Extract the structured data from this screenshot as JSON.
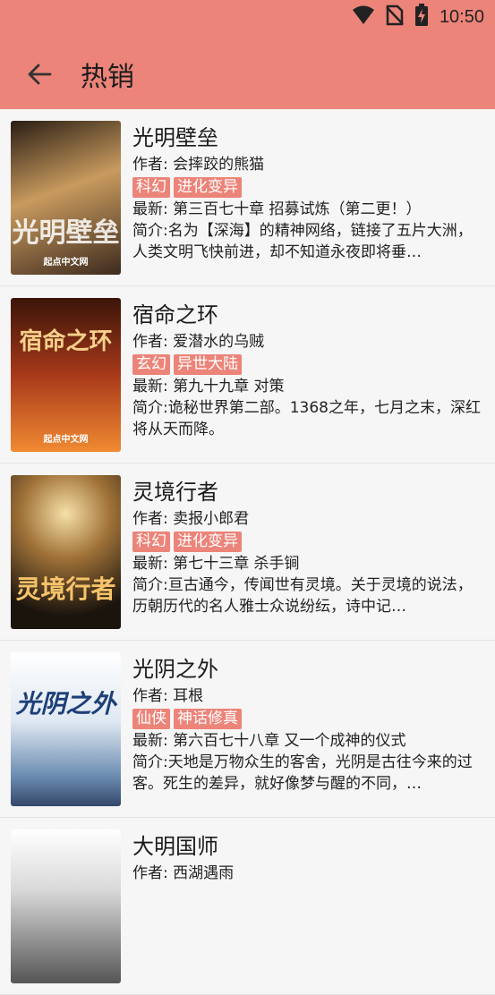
{
  "status": {
    "time": "10:50"
  },
  "toolbar": {
    "title": "热销"
  },
  "books": [
    {
      "title": "光明壁垒",
      "author": "作者: 会摔跤的熊猫",
      "tags": [
        "科幻",
        "进化变异"
      ],
      "latest": "最新: 第三百七十章 招募试炼（第二更！）",
      "intro": "简介:名为【深海】的精神网络，链接了五片大洲，人类文明飞快前进，却不知道永夜即将垂…",
      "cover_colors": [
        "#3a2a1e",
        "#d8b278",
        "#6b4f3a"
      ]
    },
    {
      "title": "宿命之环",
      "author": "作者: 爱潜水的乌贼",
      "tags": [
        "玄幻",
        "异世大陆"
      ],
      "latest": "最新: 第九十九章 对策",
      "intro": "简介:诡秘世界第二部。1368之年，七月之末，深红将从天而降。",
      "cover_colors": [
        "#2a0f08",
        "#c4481c",
        "#f39a3a"
      ]
    },
    {
      "title": "灵境行者",
      "author": "作者: 卖报小郎君",
      "tags": [
        "科幻",
        "进化变异"
      ],
      "latest": "最新: 第七十三章 杀手锏",
      "intro": "简介:亘古通今，传闻世有灵境。关于灵境的说法，历朝历代的名人雅士众说纷纭，诗中记…",
      "cover_colors": [
        "#1b140d",
        "#e8b860",
        "#6f5430"
      ]
    },
    {
      "title": "光阴之外",
      "author": "作者: 耳根",
      "tags": [
        "仙侠",
        "神话修真"
      ],
      "latest": "最新: 第六百七十八章 又一个成神的仪式",
      "intro": "简介:天地是万物众生的客舍，光阴是古往今来的过客。死生的差异，就好像梦与醒的不同，…",
      "cover_colors": [
        "#e8eef5",
        "#5d7fa8",
        "#2d3f5c"
      ]
    },
    {
      "title": "大明国师",
      "author": "作者: 西湖遇雨",
      "tags": [],
      "latest": "",
      "intro": "",
      "cover_colors": [
        "#f2f2f2",
        "#b0b0b0",
        "#444444"
      ]
    }
  ]
}
